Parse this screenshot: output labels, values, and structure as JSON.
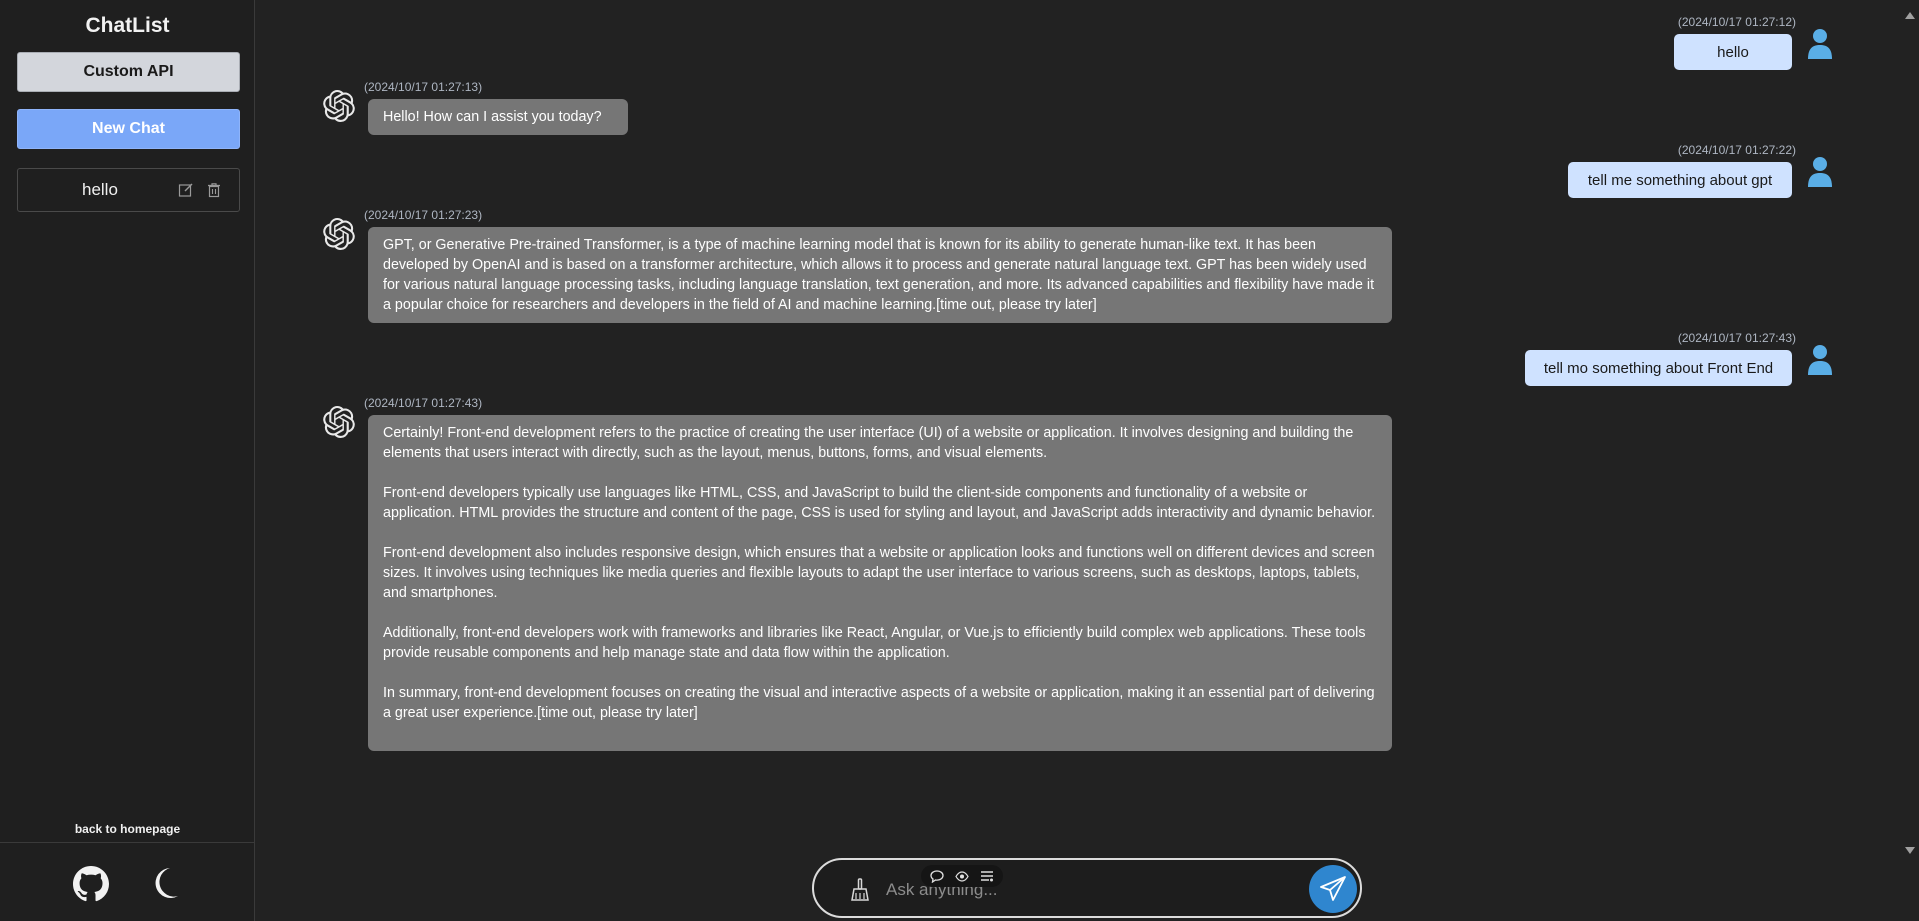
{
  "sidebar": {
    "brand": "ChatList",
    "custom_api_label": "Custom API",
    "new_chat_label": "New Chat",
    "chats": [
      {
        "label": "hello"
      }
    ],
    "back_link": "back to homepage",
    "footer_icons": [
      "github-icon",
      "moon-icon"
    ]
  },
  "messages": [
    {
      "role": "user",
      "time": "(2024/10/17 01:27:12)",
      "text": "hello"
    },
    {
      "role": "assistant",
      "time": "(2024/10/17 01:27:13)",
      "paragraphs": [
        "Hello! How can I assist you today?"
      ]
    },
    {
      "role": "user",
      "time": "(2024/10/17 01:27:22)",
      "text": "tell me something about gpt"
    },
    {
      "role": "assistant",
      "time": "(2024/10/17 01:27:23)",
      "paragraphs": [
        "GPT, or Generative Pre-trained Transformer, is a type of machine learning model that is known for its ability to generate human-like text. It has been developed by OpenAI and is based on a transformer architecture, which allows it to process and generate natural language text. GPT has been widely used for various natural language processing tasks, including language translation, text generation, and more. Its advanced capabilities and flexibility have made it a popular choice for researchers and developers in the field of AI and machine learning.[time out, please try later]"
      ]
    },
    {
      "role": "user",
      "time": "(2024/10/17 01:27:43)",
      "text": "tell mo something about Front End"
    },
    {
      "role": "assistant",
      "time": "(2024/10/17 01:27:43)",
      "paragraphs": [
        "Certainly! Front-end development refers to the practice of creating the user interface (UI) of a website or application. It involves designing and building the elements that users interact with directly, such as the layout, menus, buttons, forms, and visual elements.",
        "Front-end developers typically use languages like HTML, CSS, and JavaScript to build the client-side components and functionality of a website or application. HTML provides the structure and content of the page, CSS is used for styling and layout, and JavaScript adds interactivity and dynamic behavior.",
        "Front-end development also includes responsive design, which ensures that a website or application looks and functions well on different devices and screen sizes. It involves using techniques like media queries and flexible layouts to adapt the user interface to various screens, such as desktops, laptops, tablets, and smartphones.",
        "Additionally, front-end developers work with frameworks and libraries like React, Angular, or Vue.js to efficiently build complex web applications. These tools provide reusable components and help manage state and data flow within the application.",
        "In summary, front-end development focuses on creating the visual and interactive aspects of a website or application, making it an essential part of delivering a great user experience.[time out, please try later]"
      ]
    }
  ],
  "composer": {
    "placeholder": "Ask anything...",
    "toolbar_icons": [
      "chat-bubble-icon",
      "eye-icon",
      "list-settings-icon"
    ],
    "clear_icon": "broom-icon",
    "send_icon": "paper-plane-icon"
  },
  "colors": {
    "background": "#222222",
    "user_bubble": "#cfe2ff",
    "assistant_bubble": "#767676",
    "accent": "#7aa7f8",
    "send": "#2f86cf"
  }
}
